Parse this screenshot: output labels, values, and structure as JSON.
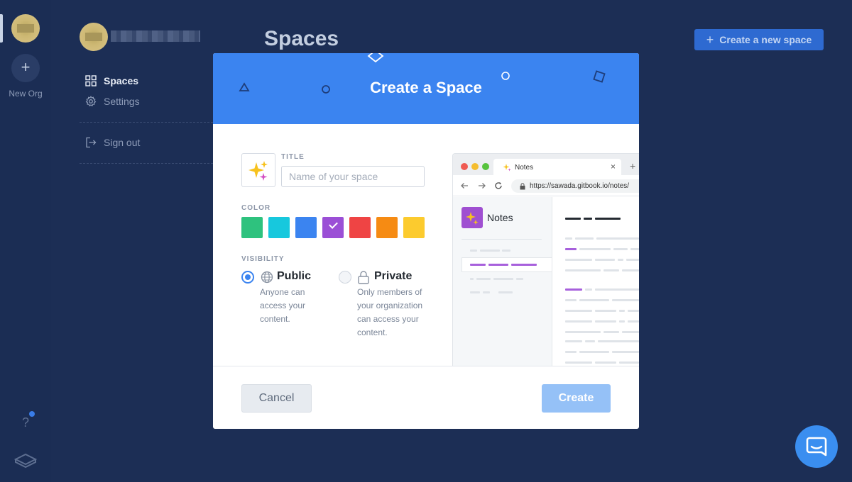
{
  "rail": {
    "new_org_label": "New Org",
    "help_label": "?"
  },
  "sidebar": {
    "items": [
      {
        "label": "Spaces",
        "icon": "grid-icon"
      },
      {
        "label": "Settings",
        "icon": "gear-icon"
      }
    ],
    "sign_out_label": "Sign out"
  },
  "main": {
    "title": "Spaces",
    "create_button_label": "Create a new space"
  },
  "modal": {
    "title": "Create a Space",
    "emoji": "sparkles-icon",
    "title_field": {
      "label": "TITLE",
      "placeholder": "Name of your space",
      "value": ""
    },
    "color": {
      "label": "COLOR",
      "swatches": [
        "#2ec27e",
        "#17c8dd",
        "#3b84f0",
        "#9b4fd6",
        "#ef4444",
        "#f68b13",
        "#fccb2e"
      ],
      "selected_index": 3
    },
    "visibility": {
      "label": "VISIBILITY",
      "options": [
        {
          "title": "Public",
          "desc": "Anyone can access your content.",
          "selected": true
        },
        {
          "title": "Private",
          "desc": "Only members of your organization can access your content.",
          "selected": false
        }
      ]
    },
    "preview": {
      "tab_label": "Notes",
      "tab_close": "×",
      "tab_new": "+",
      "url": "https://sawada.gitbook.io/notes/",
      "space_name": "Notes"
    },
    "cancel_label": "Cancel",
    "create_label": "Create"
  },
  "colors": {
    "background": "#1c2e55",
    "modal_header": "#3b84f0",
    "primary_button": "#2e6ad1",
    "create_button_disabled": "#95c1f7"
  }
}
